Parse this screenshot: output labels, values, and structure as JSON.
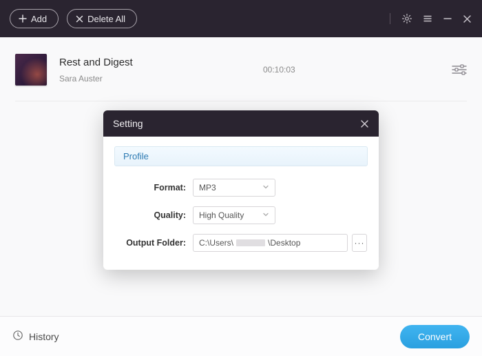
{
  "topbar": {
    "add_label": "Add",
    "delete_all_label": "Delete All"
  },
  "track": {
    "title": "Rest and Digest",
    "artist": "Sara Auster",
    "duration": "00:10:03"
  },
  "modal": {
    "title": "Setting",
    "section_label": "Profile",
    "format_label": "Format:",
    "format_value": "MP3",
    "quality_label": "Quality:",
    "quality_value": "High Quality",
    "output_label": "Output Folder:",
    "output_prefix": "C:\\Users\\",
    "output_suffix": "\\Desktop",
    "more_label": "···"
  },
  "footer": {
    "history_label": "History",
    "convert_label": "Convert"
  },
  "colors": {
    "accent_dark": "#2a2430",
    "accent_blue": "#2aa0e0"
  }
}
